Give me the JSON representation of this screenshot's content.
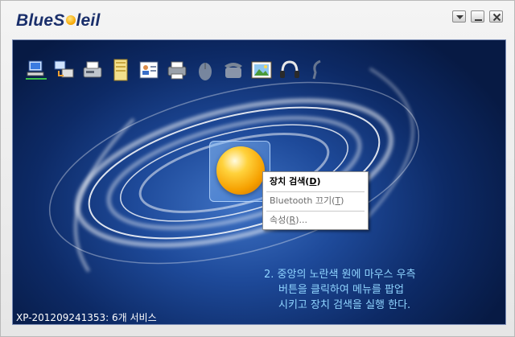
{
  "app": {
    "logo_left": "BlueS",
    "logo_right": "leil"
  },
  "window_controls": [
    {
      "name": "dropdown",
      "icon": "chevron-down-icon"
    },
    {
      "name": "minimize",
      "icon": "minimize-icon"
    },
    {
      "name": "close",
      "icon": "close-icon"
    }
  ],
  "services": [
    {
      "name": "network-access",
      "icon": "network-pc-icon"
    },
    {
      "name": "dialup-networking",
      "icon": "dialup-icon"
    },
    {
      "name": "fax",
      "icon": "fax-icon"
    },
    {
      "name": "file-transfer",
      "icon": "folder-icon"
    },
    {
      "name": "pim-sync",
      "icon": "business-card-icon"
    },
    {
      "name": "printer",
      "icon": "printer-icon"
    },
    {
      "name": "mouse",
      "icon": "mouse-icon"
    },
    {
      "name": "phone",
      "icon": "phone-icon"
    },
    {
      "name": "picture",
      "icon": "picture-icon"
    },
    {
      "name": "headset",
      "icon": "headphones-icon"
    },
    {
      "name": "headset-mono",
      "icon": "headset-icon"
    }
  ],
  "context_menu": {
    "search_label": "장치 검색(",
    "search_key": "D",
    "search_close": ")",
    "bt_off_label": "Bluetooth 끄기(",
    "bt_off_key": "T",
    "bt_off_close": ")",
    "props_label": "속성(",
    "props_key": "R",
    "props_close": ")..."
  },
  "hint": {
    "line1": "2. 중앙의 노란색 원에 마우스 우측",
    "line2": "버튼을 클릭하여 메뉴를  팝업",
    "line3": "시키고 장치 검색을 실행 한다."
  },
  "status": {
    "text": "XP-201209241353: 6개 서비스"
  },
  "colors": {
    "background_center": "#3e72c4",
    "background_edge": "#071a44",
    "hint_text": "#8fd4ff",
    "orb": "#f6a000"
  }
}
